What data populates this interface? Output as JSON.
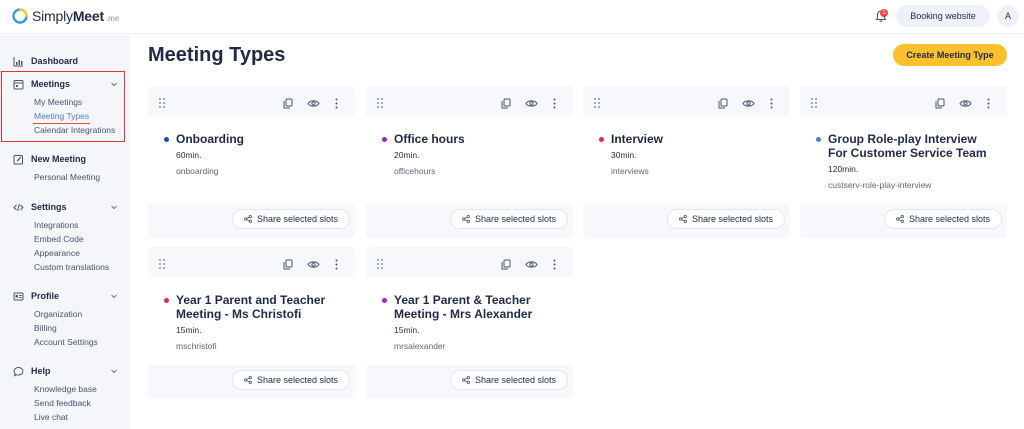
{
  "app": {
    "logo_text_regular": "Simply",
    "logo_text_bold": "Meet",
    "logo_suffix": ".me",
    "notification_count": "1",
    "booking_website_label": "Booking website",
    "avatar_initial": "A"
  },
  "sidebar": {
    "dashboard": "Dashboard",
    "meetings": {
      "label": "Meetings",
      "items": [
        "My Meetings",
        "Meeting Types",
        "Calendar Integrations"
      ]
    },
    "new_meeting": {
      "label": "New Meeting",
      "items": [
        "Personal Meeting"
      ]
    },
    "settings": {
      "label": "Settings",
      "items": [
        "Integrations",
        "Embed Code",
        "Appearance",
        "Custom translations"
      ]
    },
    "profile": {
      "label": "Profile",
      "items": [
        "Organization",
        "Billing",
        "Account Settings"
      ]
    },
    "help": {
      "label": "Help",
      "items": [
        "Knowledge base",
        "Send feedback",
        "Live chat"
      ]
    }
  },
  "main": {
    "title": "Meeting Types",
    "create_label": "Create Meeting Type",
    "share_label": "Share selected slots",
    "cards": [
      {
        "title": "Onboarding",
        "duration": "60min.",
        "slug": "onboarding",
        "dot_color": "#2a3fd6"
      },
      {
        "title": "Office hours",
        "duration": "20min.",
        "slug": "officehours",
        "dot_color": "#9b22d6"
      },
      {
        "title": "Interview",
        "duration": "30min.",
        "slug": "interviews",
        "dot_color": "#e0245e"
      },
      {
        "title": "Group Role-play Interview For Customer Service Team",
        "duration": "120min.",
        "slug": "custserv-role-play-interview",
        "dot_color": "#2f8ad8"
      },
      {
        "title": "Year 1 Parent and Teacher Meeting - Ms Christofi",
        "duration": "15min.",
        "slug": "mschristofi",
        "dot_color": "#e0245e"
      },
      {
        "title": "Year 1 Parent & Teacher Meeting - Mrs Alexander",
        "duration": "15min.",
        "slug": "mrsalexander",
        "dot_color": "#9b22d6"
      }
    ]
  },
  "colors": {
    "accent": "#fbc02d",
    "active_link": "#4f7fd8",
    "highlight": "#e0353b"
  }
}
